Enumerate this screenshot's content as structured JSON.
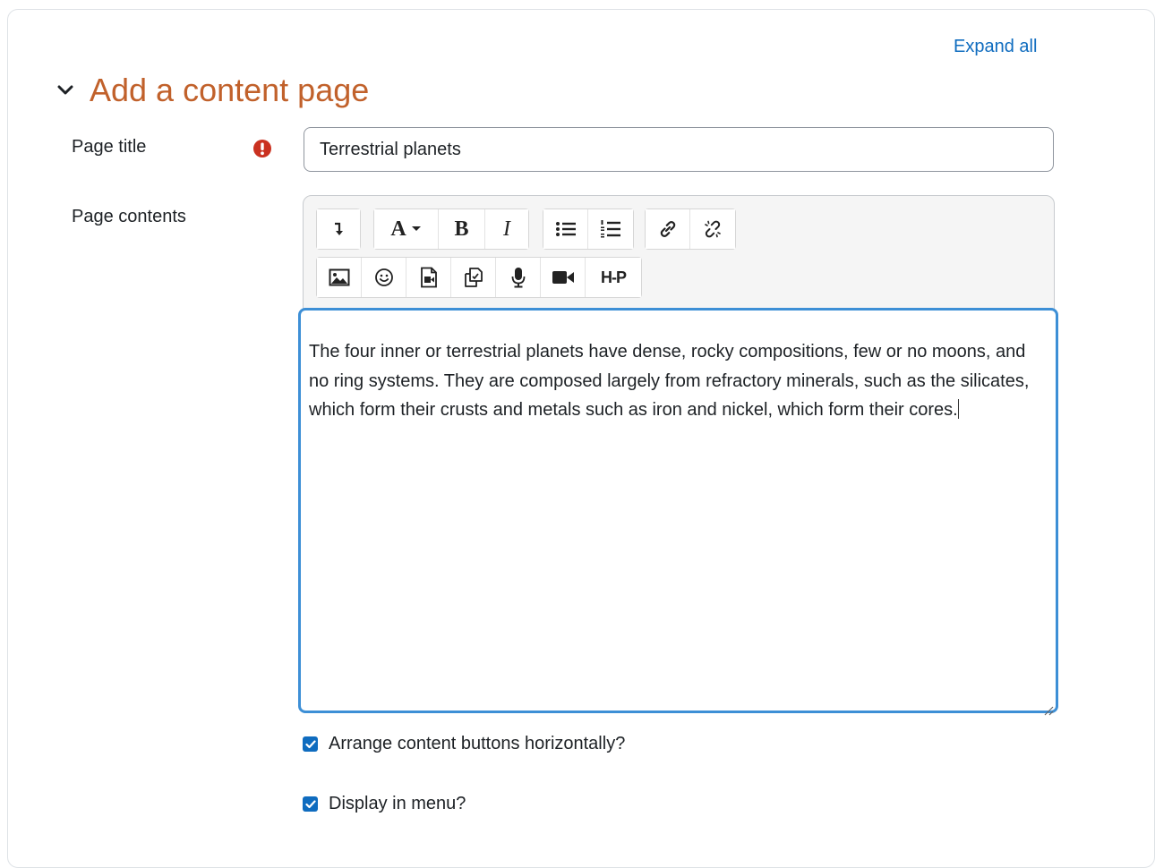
{
  "header": {
    "expand_all": "Expand all",
    "section_title": "Add a content page"
  },
  "fields": {
    "page_title_label": "Page title",
    "page_title_value": "Terrestrial planets",
    "page_contents_label": "Page contents"
  },
  "editor": {
    "toolbar_row1": [
      {
        "name": "paragraph-direction-icon"
      },
      {
        "name": "font-style-icon",
        "text": "A"
      },
      {
        "name": "bold-icon",
        "text": "B"
      },
      {
        "name": "italic-icon",
        "text": "I"
      },
      {
        "name": "unordered-list-icon"
      },
      {
        "name": "ordered-list-icon"
      },
      {
        "name": "link-icon"
      },
      {
        "name": "unlink-icon"
      }
    ],
    "toolbar_row2": [
      {
        "name": "image-icon"
      },
      {
        "name": "emoji-icon"
      },
      {
        "name": "media-icon"
      },
      {
        "name": "manage-files-icon"
      },
      {
        "name": "record-audio-icon"
      },
      {
        "name": "record-video-icon"
      },
      {
        "name": "h5p-icon",
        "text": "H-P"
      }
    ],
    "content": "The four inner or terrestrial planets have dense, rocky compositions, few or no moons, and no ring systems. They are composed largely from refractory minerals, such as the silicates, which form their crusts and metals such as iron and nickel, which form their cores."
  },
  "options": {
    "arrange_horizontally": {
      "label": "Arrange content buttons horizontally?",
      "checked": true
    },
    "display_in_menu": {
      "label": "Display in menu?",
      "checked": true
    }
  },
  "colors": {
    "accent": "#0f6cbf",
    "title": "#c1612b",
    "required": "#ca3120",
    "focus": "#3d8fd6"
  }
}
